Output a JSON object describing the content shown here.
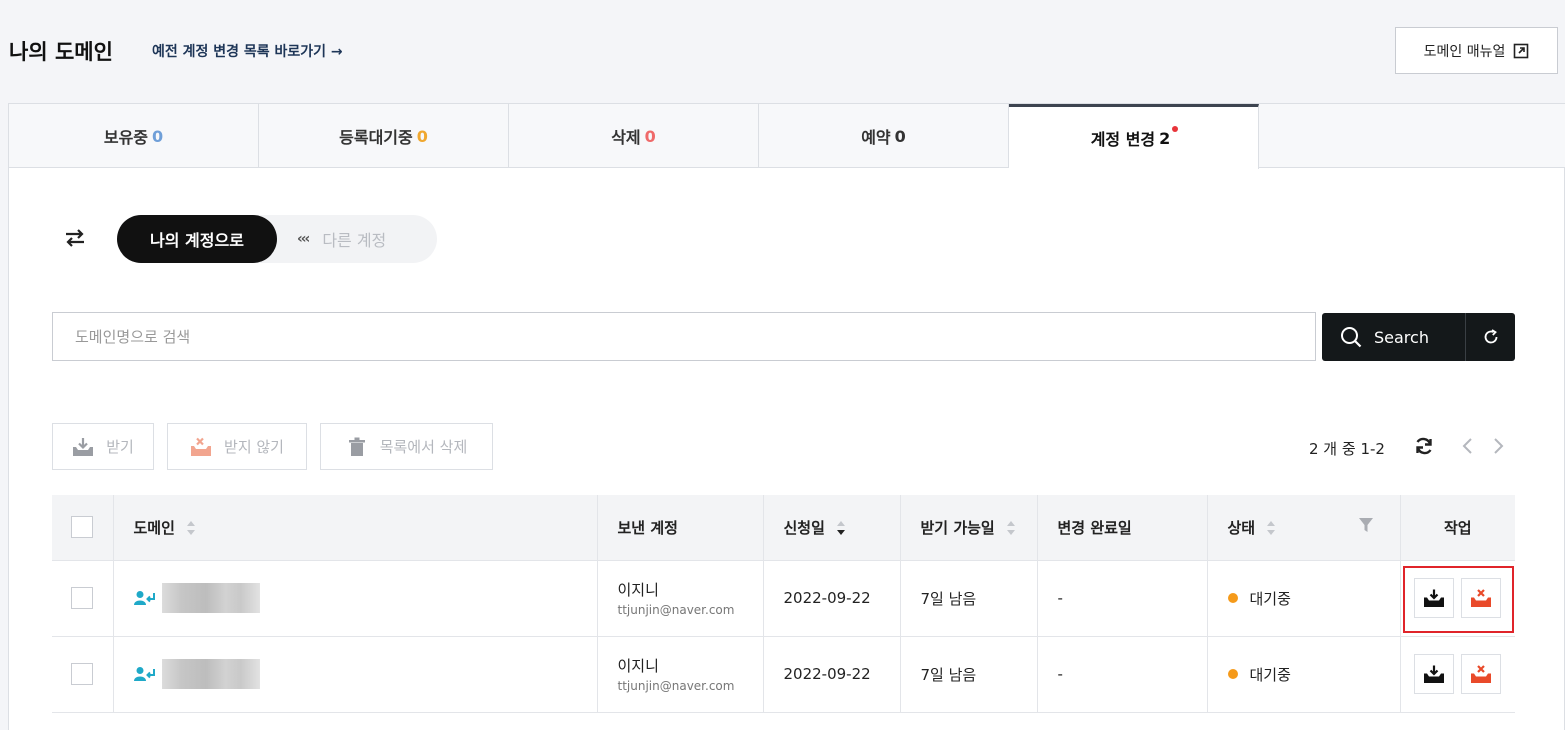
{
  "header": {
    "title": "나의 도메인",
    "old_link": "예전 계정 변경 목록 바로가기 →",
    "manual_label": "도메인 매뉴얼"
  },
  "tabs": [
    {
      "label": "보유중",
      "count": "0",
      "count_color": "#6f9fd8"
    },
    {
      "label": "등록대기중",
      "count": "0",
      "count_color": "#f0a830"
    },
    {
      "label": "삭제",
      "count": "0",
      "count_color": "#ef6a6a"
    },
    {
      "label": "예약",
      "count": "0",
      "count_color": "#333333"
    },
    {
      "label": "계정 변경",
      "count": "2",
      "count_color": "#111111",
      "active": true
    }
  ],
  "toggle": {
    "active_label": "나의 계정으로",
    "inactive_arrows": "‹‹‹",
    "inactive_label": "다른 계정"
  },
  "search": {
    "placeholder": "도메인명으로 검색",
    "button_label": "Search"
  },
  "actions": {
    "receive": "받기",
    "decline": "받지 않기",
    "delete": "목록에서 삭제"
  },
  "pager": {
    "summary": "2 개 중 1-2"
  },
  "table": {
    "columns": [
      "도메인",
      "보낸 계정",
      "신청일",
      "받기 가능일",
      "변경 완료일",
      "상태",
      "작업"
    ],
    "rows": [
      {
        "sender_name": "이지니",
        "sender_email": "ttjunjin@naver.com",
        "request_date": "2022-09-22",
        "available": "7일 남음",
        "completed": "-",
        "status": "대기중"
      },
      {
        "sender_name": "이지니",
        "sender_email": "ttjunjin@naver.com",
        "request_date": "2022-09-22",
        "available": "7일 남음",
        "completed": "-",
        "status": "대기중"
      }
    ]
  },
  "colors": {
    "status_waiting": "#f59a1a",
    "decline": "#e94a2a",
    "highlight": "#e0242a",
    "new_dot": "#e8343a"
  }
}
